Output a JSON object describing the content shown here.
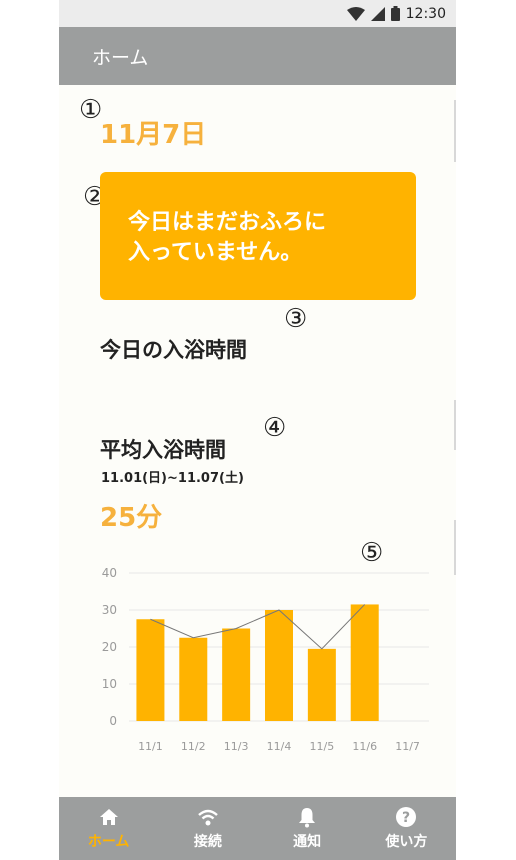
{
  "status_bar": {
    "time": "12:30"
  },
  "app_bar": {
    "title": "ホーム"
  },
  "markers": {
    "m1": "①",
    "m2": "②",
    "m3": "③",
    "m4": "④",
    "m5": "⑤"
  },
  "today": {
    "date": "11月7日",
    "status_line1": "今日はまだおふろに",
    "status_line2": "入っていません。",
    "bath_time_title": "今日の入浴時間"
  },
  "average": {
    "title": "平均入浴時間",
    "period": "11.01(日)~11.07(土)",
    "value": "25分"
  },
  "chart_data": {
    "type": "bar",
    "categories": [
      "11/1",
      "11/2",
      "11/3",
      "11/4",
      "11/5",
      "11/6",
      "11/7"
    ],
    "values": [
      27.5,
      22.5,
      25,
      30,
      19.5,
      31.5,
      null
    ],
    "line_values": [
      27.5,
      22.5,
      25,
      30,
      19.5,
      31.5
    ],
    "ylim": [
      0,
      40
    ],
    "yticks": [
      "0",
      "10",
      "20",
      "30",
      "40"
    ],
    "grid": true,
    "bar_color": "#ffb300",
    "line_color": "#777777"
  },
  "bottom_nav": [
    {
      "label": "ホーム",
      "icon": "home-icon",
      "active": true
    },
    {
      "label": "接続",
      "icon": "wifi-icon",
      "active": false
    },
    {
      "label": "通知",
      "icon": "bell-icon",
      "active": false
    },
    {
      "label": "使い方",
      "icon": "help-icon",
      "active": false
    }
  ],
  "colors": {
    "accent": "#ffb300",
    "date": "#f6b13d",
    "app_bar": "#9c9e9e"
  }
}
